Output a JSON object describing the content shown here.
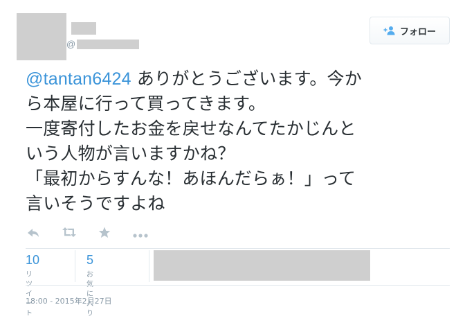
{
  "header": {
    "handle_prefix": "@",
    "follow_label": "フォロー"
  },
  "tweet": {
    "mention": "@tantan6424",
    "line1_rest": " ありがとうございます。今か",
    "line2": "ら本屋に行って買ってきます。",
    "line3": "一度寄付したお金を戻せなんてたかじんと",
    "line4": "いう人物が言いますかね？",
    "line5": "「最初からすんな！あほんだらぁ！」って",
    "line6": "言いそうですよね"
  },
  "actions": {
    "icons": [
      "reply-icon",
      "retweet-icon",
      "favorite-icon",
      "more-icon"
    ],
    "icon_color": "#b6c3cc"
  },
  "stats": {
    "retweets_count": "10",
    "retweets_label": "リツイート",
    "favorites_count": "5",
    "favorites_label": "お気に入り"
  },
  "timestamp": "18:00 - 2015年2月27日",
  "colors": {
    "link": "#3b94d9",
    "text": "#292f33",
    "muted": "#8899a6",
    "redaction": "#cfcfcf",
    "border": "#e1e8ed"
  }
}
